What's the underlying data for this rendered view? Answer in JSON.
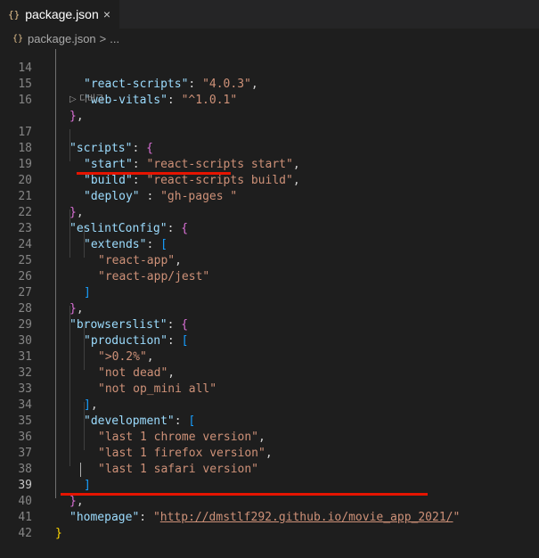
{
  "tab": {
    "icon": "{}",
    "title": "package.json",
    "close": "×"
  },
  "breadcrumb": {
    "icon": "{}",
    "file": "package.json",
    "separator": ">",
    "more": "..."
  },
  "codelens": "▷ 디버그",
  "lines": {
    "l14": {
      "num": "14",
      "key": "\"react-scripts\"",
      "colon": ": ",
      "value": "\"4.0.3\"",
      "tail": ","
    },
    "l15": {
      "num": "15",
      "key": "\"web-vitals\"",
      "colon": ": ",
      "value": "\"^1.0.1\""
    },
    "l16": {
      "num": "16",
      "brace": "}",
      "tail": ","
    },
    "l17": {
      "num": "17",
      "key": "\"scripts\"",
      "colon": ": ",
      "brace": "{"
    },
    "l18": {
      "num": "18",
      "key": "\"start\"",
      "colon": ": ",
      "value": "\"react-scripts start\"",
      "tail": ","
    },
    "l19": {
      "num": "19",
      "key": "\"build\"",
      "colon": ": ",
      "value": "\"react-scripts build\"",
      "tail": ","
    },
    "l20": {
      "num": "20",
      "key": "\"deploy\"",
      "colon": " : ",
      "value": "\"gh-pages \""
    },
    "l21": {
      "num": "21",
      "brace": "}",
      "tail": ","
    },
    "l22": {
      "num": "22",
      "key": "\"eslintConfig\"",
      "colon": ": ",
      "brace": "{"
    },
    "l23": {
      "num": "23",
      "key": "\"extends\"",
      "colon": ": ",
      "brace": "["
    },
    "l24": {
      "num": "24",
      "value": "\"react-app\"",
      "tail": ","
    },
    "l25": {
      "num": "25",
      "value": "\"react-app/jest\""
    },
    "l26": {
      "num": "26",
      "brace": "]"
    },
    "l27": {
      "num": "27",
      "brace": "}",
      "tail": ","
    },
    "l28": {
      "num": "28",
      "key": "\"browserslist\"",
      "colon": ": ",
      "brace": "{"
    },
    "l29": {
      "num": "29",
      "key": "\"production\"",
      "colon": ": ",
      "brace": "["
    },
    "l30": {
      "num": "30",
      "value": "\">0.2%\"",
      "tail": ","
    },
    "l31": {
      "num": "31",
      "value": "\"not dead\"",
      "tail": ","
    },
    "l32": {
      "num": "32",
      "value": "\"not op_mini all\""
    },
    "l33": {
      "num": "33",
      "brace": "]",
      "tail": ","
    },
    "l34": {
      "num": "34",
      "key": "\"development\"",
      "colon": ": ",
      "brace": "["
    },
    "l35": {
      "num": "35",
      "value": "\"last 1 chrome version\"",
      "tail": ","
    },
    "l36": {
      "num": "36",
      "value": "\"last 1 firefox version\"",
      "tail": ","
    },
    "l37": {
      "num": "37",
      "value": "\"last 1 safari version\""
    },
    "l38": {
      "num": "38",
      "brace": "]"
    },
    "l39": {
      "num": "39",
      "brace": "}",
      "tail": ","
    },
    "l40": {
      "num": "40",
      "key": "\"homepage\"",
      "colon": ": ",
      "quote": "\"",
      "link": "http://dmstlf292.github.io/movie_app_2021/"
    },
    "l41": {
      "num": "41",
      "brace": "}"
    },
    "l42": {
      "num": "42"
    }
  },
  "colors": {
    "background": "#1e1e1e",
    "key": "#9cdcfe",
    "string": "#ce9178",
    "annotation": "#e51400"
  }
}
